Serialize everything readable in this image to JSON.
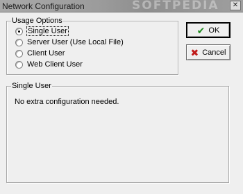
{
  "window": {
    "title": "Network Configuration",
    "watermark": "SOFTPEDIA",
    "close_glyph": "✕"
  },
  "usage_options": {
    "legend": "Usage Options",
    "selected": "Single User",
    "options": [
      {
        "label": "Single User",
        "checked": true
      },
      {
        "label": "Server User (Use Local File)",
        "checked": false
      },
      {
        "label": "Client User",
        "checked": false
      },
      {
        "label": "Web Client User",
        "checked": false
      }
    ]
  },
  "details": {
    "legend": "Single User",
    "message": "No extra configuration needed."
  },
  "buttons": {
    "ok_label": "OK",
    "ok_icon": "check-icon",
    "ok_glyph": "✔",
    "cancel_label": "Cancel",
    "cancel_icon": "x-icon",
    "cancel_glyph": "✖"
  },
  "colors": {
    "ok_icon": "#1e8a1e",
    "cancel_icon": "#c01a1a"
  }
}
